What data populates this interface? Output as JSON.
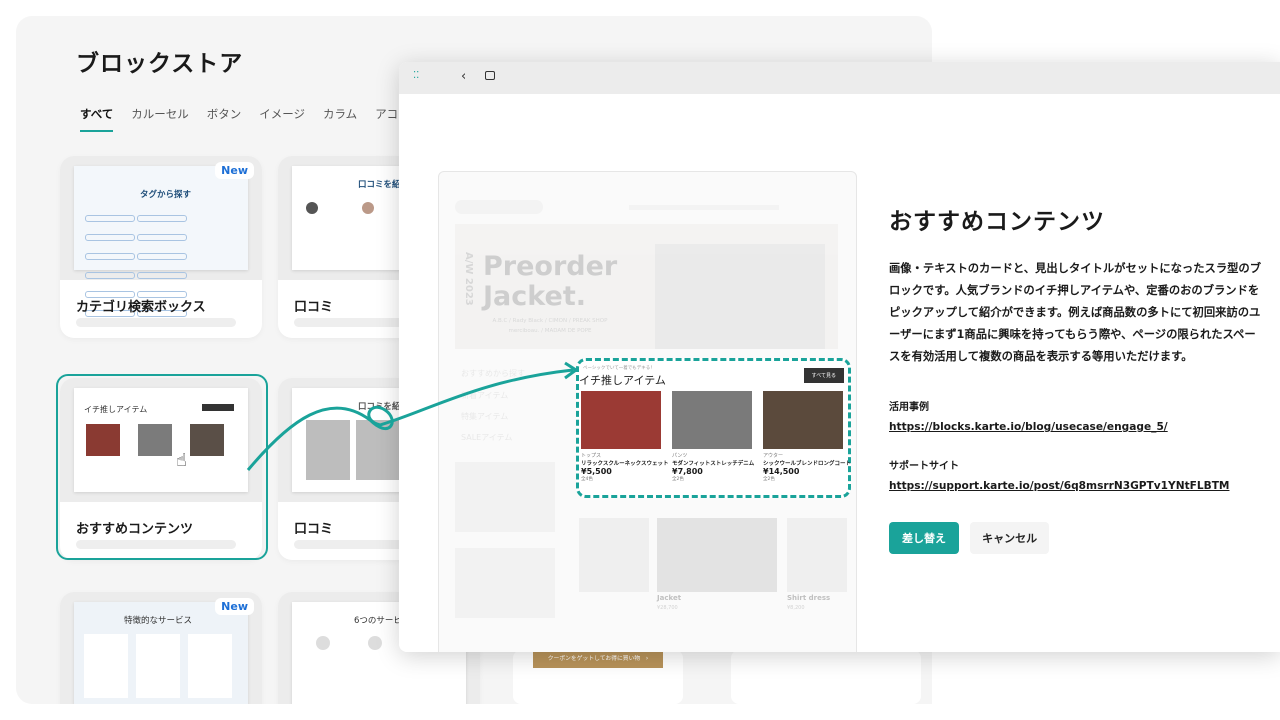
{
  "store": {
    "title": "ブロックストア",
    "tabs": [
      "すべて",
      "カルーセル",
      "ボタン",
      "イメージ",
      "カラム",
      "アコーディ"
    ],
    "new_badge": "New",
    "cards": [
      {
        "title": "カテゴリ検索ボックス",
        "thumb_heading": "タグから探す"
      },
      {
        "title": "口コミ",
        "thumb_heading": "口コミを紹"
      },
      {
        "title": "おすすめコンテンツ",
        "thumb_heading": "イチ推しアイテム"
      },
      {
        "title": "口コミ",
        "thumb_heading": "口コミを紹"
      },
      {
        "title": "",
        "thumb_heading": "特徴的なサービス"
      },
      {
        "title": "",
        "thumb_heading": "6つのサービ"
      }
    ],
    "coupon_text": "クーポンをゲットしてお得に買い物　›"
  },
  "modal": {
    "title": "おすすめコンテンツ",
    "description": "画像・テキストのカードと、見出しタイトルがセットになったスラ型のブロックです。人気ブランドのイチ押しアイテムや、定番のおのブランドをピックアップして紹介ができます。例えば商品数の多トにて初回来訪のユーザーにまず1商品に興味を持ってもらう際や、ページの限られたスペースを有効活用して複数の商品を表示する等用いただけます。",
    "usecase_label": "活用事例",
    "usecase_link": "https://blocks.karte.io/blog/usecase/engage_5/",
    "support_label": "サポートサイト",
    "support_link": "https://support.karte.io/post/6q8msrrN3GPTv1YNtFLBTM",
    "replace_button": "差し替え",
    "cancel_button": "キャンセル"
  },
  "preview": {
    "hero_title_1": "Preorder",
    "hero_title_2": "Jacket.",
    "hero_vertical": "A/W 2023",
    "hero_sub": "A.B.C / Rady Black / CIMON / PREAK SHOP merciboau. / MADAM DE POPE",
    "side_items": [
      "おすすめから探す",
      "新着アイテム",
      "特集アイテム",
      "SALEアイテム"
    ],
    "section_caption": "イチ推しアイテム",
    "section_small": "ベーシックでいて一着でもデキる！",
    "see_all": "すべて見る",
    "products": [
      {
        "cat": "トップス",
        "name": "リラックスクルーネックスウェット",
        "price": "¥5,500",
        "stock": "全4色"
      },
      {
        "cat": "パンツ",
        "name": "モダンフィットストレッチデニム",
        "price": "¥7,800",
        "stock": "全2色"
      },
      {
        "cat": "アウター",
        "name": "シックウールブレンドロングコート",
        "price": "¥14,500",
        "stock": "全2色"
      }
    ],
    "lower_items": [
      {
        "name": "Jacket",
        "price": "¥28,700"
      },
      {
        "name": "Shirt dress",
        "price": "¥8,200"
      }
    ]
  }
}
